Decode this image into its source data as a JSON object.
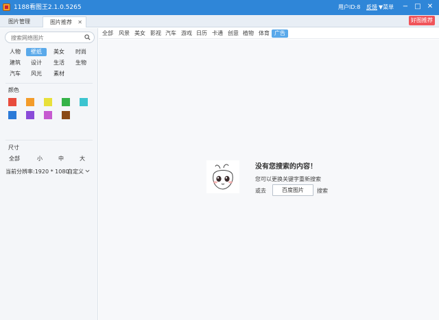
{
  "titlebar": {
    "title": "1188看图王2.1.0.5265",
    "user_id": "用户ID:8",
    "feedback": "反馈",
    "menu": "▼菜单",
    "minimize": "−",
    "maximize": "□",
    "close": "✕"
  },
  "tabs": [
    {
      "label": "图片管理"
    },
    {
      "label": "图片推荐",
      "close": "✕"
    }
  ],
  "recommend_button": "好图推荐",
  "sidebar": {
    "search_placeholder": "搜索网络图片",
    "categories": [
      "人物",
      "壁纸",
      "美女",
      "时尚",
      "建筑",
      "设计",
      "生活",
      "生物",
      "汽车",
      "风光",
      "素材"
    ],
    "active_category": "壁纸",
    "color_label": "颜色",
    "colors": [
      "#e84c3d",
      "#f39c2a",
      "#e8e03a",
      "#35b349",
      "#3cc4d0",
      "#2b7ad8",
      "#8a4bd8",
      "#c65ad0",
      "#8b4a16"
    ],
    "size_label": "尺寸",
    "sizes": [
      "全部",
      "小",
      "中",
      "大"
    ],
    "resolution": "当前分辨率:1920 * 1080",
    "custom": "自定义"
  },
  "topcats": [
    "全部",
    "风景",
    "美女",
    "影视",
    "汽车",
    "游戏",
    "日历",
    "卡通",
    "创意",
    "植物",
    "体育",
    "广告"
  ],
  "active_topcat": "广告",
  "empty": {
    "title": "没有您搜索的内容！",
    "hint": "您可以更换关键字重新搜索",
    "or": "或去",
    "baidu_button": "百度图片",
    "search": "搜索"
  }
}
